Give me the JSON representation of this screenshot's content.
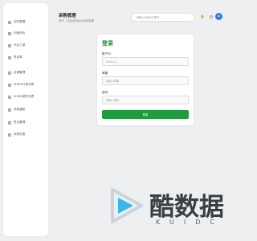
{
  "header": {
    "title": "采购管理",
    "subtitle": "您好，欢迎来到后台系统管理"
  },
  "search": {
    "placeholder": "请输入商品/订单号"
  },
  "avatar": {
    "initials": "A"
  },
  "sidebar": {
    "items": [
      {
        "label": "实时数据",
        "icon": "circle-icon"
      },
      {
        "label": "利润分析",
        "icon": "circle-icon"
      },
      {
        "label": "代办工单",
        "icon": "circle-icon"
      },
      {
        "label": "售后单",
        "icon": "circle-icon"
      },
      {
        "label": "店铺管理",
        "icon": "circle-icon"
      },
      {
        "label": "SHEIN订单列表",
        "icon": "circle-icon"
      },
      {
        "label": "SHEIN退货列表",
        "icon": "circle-icon"
      },
      {
        "label": "消息通知",
        "icon": "circle-icon"
      },
      {
        "label": "售后管理",
        "icon": "circle-icon"
      },
      {
        "label": "采购列表",
        "icon": "circle-icon"
      }
    ]
  },
  "login": {
    "title": "登录",
    "account_label": "账户ID",
    "account_value": "Seller_A",
    "email_label": "邮箱",
    "email_placeholder": "请输入邮箱",
    "password_label": "密码",
    "password_placeholder": "请输入密码",
    "submit_label": "登录"
  },
  "watermark": {
    "text": "酷数据",
    "sub": "KUIDC"
  },
  "colors": {
    "accent": "#1f9a3f",
    "title_green": "#1e8c3a",
    "avatar_blue": "#2f7de1",
    "watermark_play": "#38b8e8"
  }
}
